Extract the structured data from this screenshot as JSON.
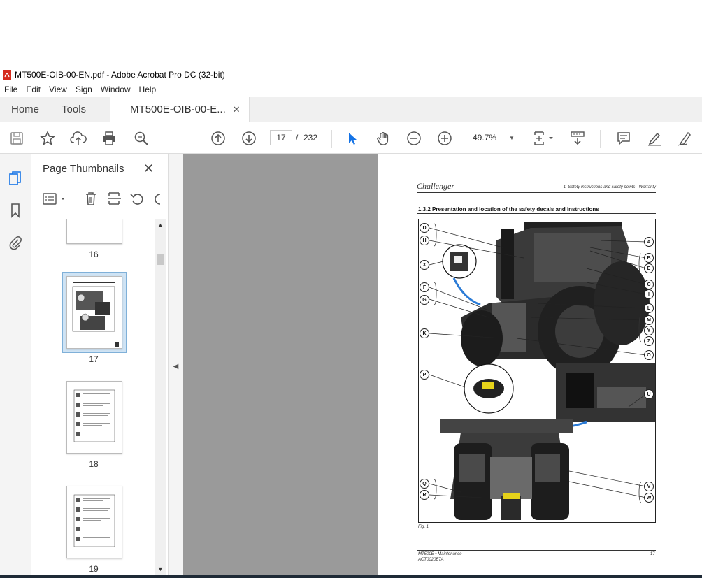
{
  "window": {
    "title": "MT500E-OIB-00-EN.pdf - Adobe Acrobat Pro DC (32-bit)"
  },
  "menu": [
    "File",
    "Edit",
    "View",
    "Sign",
    "Window",
    "Help"
  ],
  "tabs": {
    "home": "Home",
    "tools": "Tools",
    "document": "MT500E-OIB-00-E...",
    "close": "✕"
  },
  "toolbar": {
    "current_page": "17",
    "page_sep": "/",
    "total_pages": "232",
    "zoom": "49.7%"
  },
  "panel": {
    "title": "Page Thumbnails",
    "close": "✕",
    "thumbnails": [
      {
        "label": "16"
      },
      {
        "label": "17",
        "selected": true
      },
      {
        "label": "18"
      },
      {
        "label": "19"
      }
    ]
  },
  "page": {
    "brand": "Challenger",
    "header_right": "1. Safety instructions and safety points - Warranty",
    "section_title": "1.3.2  Presentation and location of the safety decals and instructions",
    "figure_caption": "Fig. 1",
    "footer_left_1": "MT500E • Maintenance",
    "footer_left_2": "ACT0020E7A",
    "footer_page": "17",
    "callouts_left": [
      "D",
      "H",
      "X",
      "F",
      "G",
      "K",
      "P",
      "Q",
      "R"
    ],
    "callouts_right": [
      "A",
      "B",
      "E",
      "C",
      "I",
      "L",
      "M",
      "Y",
      "Z",
      "O",
      "U",
      "V",
      "W"
    ]
  }
}
